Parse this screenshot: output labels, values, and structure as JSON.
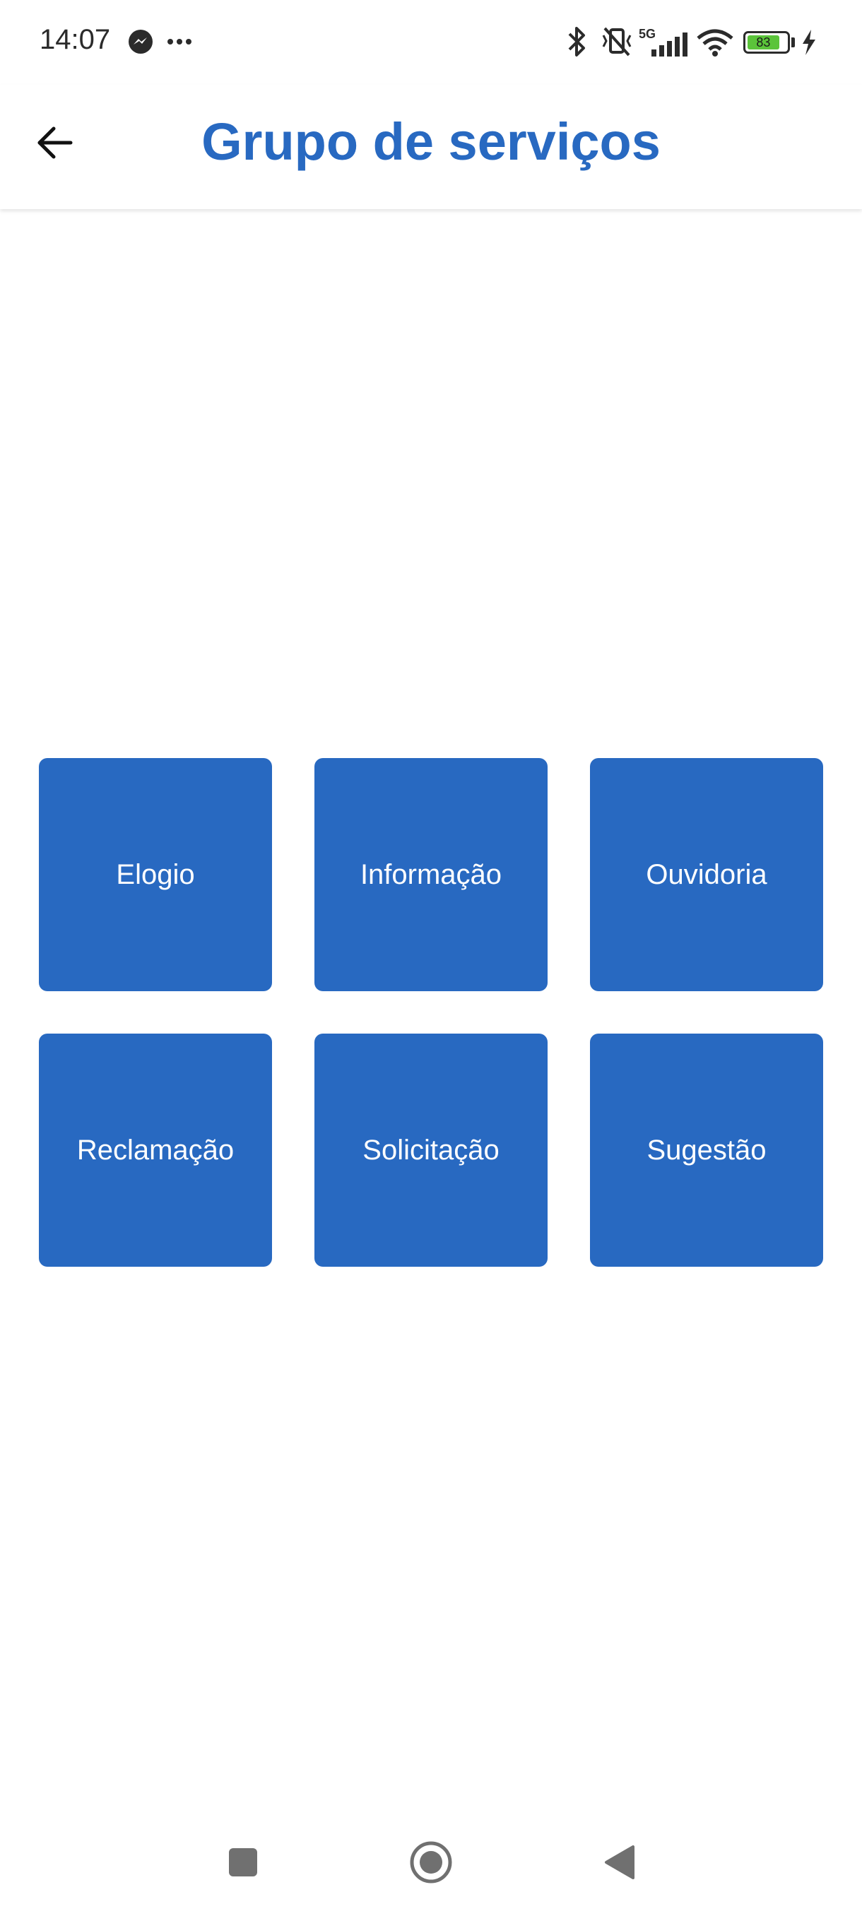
{
  "status_bar": {
    "time": "14:07",
    "network": "5G",
    "battery": "83",
    "icons": [
      "messenger-icon",
      "more-dots-icon",
      "bluetooth-icon",
      "vibrate-icon",
      "signal-icon",
      "wifi-icon",
      "battery-icon",
      "charging-icon"
    ]
  },
  "header": {
    "title": "Grupo de serviços",
    "back_icon": "arrow-left-icon"
  },
  "services": [
    {
      "label": "Elogio"
    },
    {
      "label": "Informação"
    },
    {
      "label": "Ouvidoria"
    },
    {
      "label": "Reclamação"
    },
    {
      "label": "Solicitação"
    },
    {
      "label": "Sugestão"
    }
  ],
  "colors": {
    "primary": "#2869c1",
    "tile_text": "#ffffff",
    "background": "#ffffff"
  },
  "nav_bar": {
    "buttons": [
      "recents-square-icon",
      "home-circle-icon",
      "back-triangle-icon"
    ]
  }
}
